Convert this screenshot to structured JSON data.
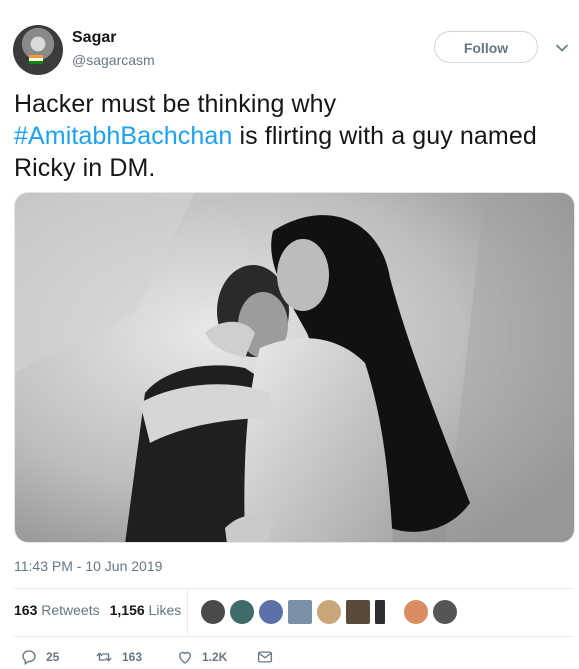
{
  "tweet": {
    "author": {
      "name": "Sagar",
      "handle": "@sagarcasm",
      "avatar_icon": "user-avatar"
    },
    "follow_label": "Follow",
    "text_before": "Hacker must be thinking why ",
    "hashtag": "#AmitabhBachchan",
    "text_after": " is flirting with a guy named Ricky in DM.",
    "timestamp": "11:43 PM - 10 Jun 2019",
    "stats": {
      "retweets_count": "163",
      "retweets_label": "Retweets",
      "likes_count": "1,156",
      "likes_label": "Likes"
    },
    "actions": {
      "replies": "25",
      "retweets": "163",
      "likes": "1.2K"
    }
  },
  "colors": {
    "text": "#14171a",
    "muted": "#657786",
    "link": "#1da1f2",
    "border": "#e6ecf0"
  }
}
